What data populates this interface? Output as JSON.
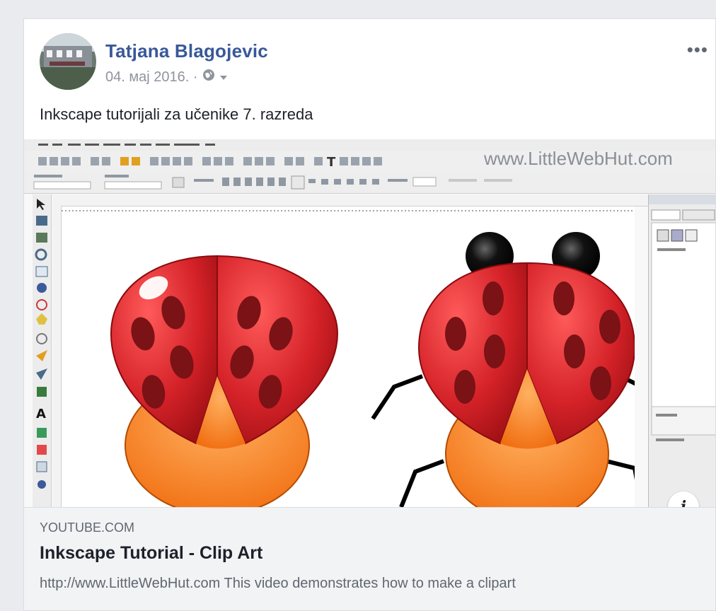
{
  "post": {
    "author": "Tatjana Blagojevic",
    "date": "04. мај 2016. ·",
    "text": "Inkscape tutorijali za učenike 7. razreda",
    "more_label": "•••"
  },
  "preview": {
    "watermark": "www.LittleWebHut.com"
  },
  "link": {
    "domain": "YOUTUBE.COM",
    "title": "Inkscape Tutorial - Clip Art",
    "description": "http://www.LittleWebHut.com This video demonstrates how to make a clipart",
    "info_label": "i"
  },
  "colors": {
    "name": "#385898",
    "ladybug_red": "#cc1f26",
    "ladybug_orange": "#ff7a1a"
  }
}
